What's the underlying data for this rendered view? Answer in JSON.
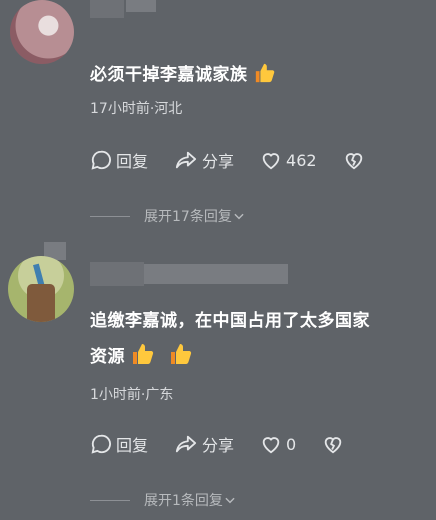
{
  "comments": [
    {
      "text": "必须干掉李嘉诚家族",
      "emoji": "thumbs-up",
      "meta": "17小时前·河北",
      "reply_label": "回复",
      "share_label": "分享",
      "likes": "462",
      "expand_label": "展开17条回复"
    },
    {
      "text_line1": "追缴李嘉诚，在中国占用了太多国家",
      "text_line2": "资源",
      "emoji": "thumbs-up",
      "meta": "1小时前·广东",
      "reply_label": "回复",
      "share_label": "分享",
      "likes": "0",
      "expand_label": "展开1条回复"
    }
  ],
  "colors": {
    "background": "#5f6368",
    "text": "#ffffff",
    "meta": "#d6d8db"
  }
}
